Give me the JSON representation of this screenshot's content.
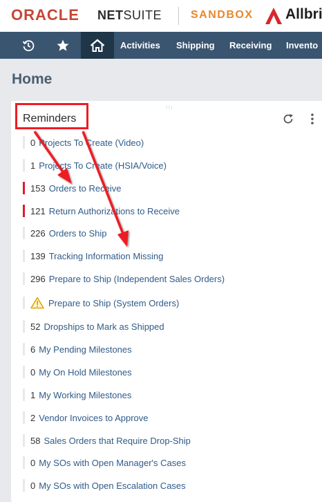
{
  "header": {
    "brand_oracle": "ORACLE",
    "brand_netsuite_bold": "NET",
    "brand_netsuite_rest": "SUITE",
    "environment": "SANDBOX",
    "company": "Allbri"
  },
  "nav": {
    "icons": [
      "recent-records-icon",
      "favorites-star-icon",
      "home-icon"
    ],
    "items": [
      "Activities",
      "Shipping",
      "Receiving",
      "Invento"
    ]
  },
  "page": {
    "title": "Home"
  },
  "portlet": {
    "title": "Reminders",
    "reminders": [
      {
        "count": "0",
        "label": "Projects To Create (Video)",
        "alert": false
      },
      {
        "count": "1",
        "label": "Projects To Create (HSIA/Voice)",
        "alert": false
      },
      {
        "count": "153",
        "label": "Orders to Receive",
        "alert": true
      },
      {
        "count": "121",
        "label": "Return Authorizations to Receive",
        "alert": true
      },
      {
        "count": "226",
        "label": "Orders to Ship",
        "alert": false
      },
      {
        "count": "139",
        "label": "Tracking Information Missing",
        "alert": false
      },
      {
        "count": "296",
        "label": "Prepare to Ship (Independent Sales Orders)",
        "alert": false
      },
      {
        "count": "",
        "label": "Prepare to Ship (System Orders)",
        "alert": false,
        "warning": true
      },
      {
        "count": "52",
        "label": "Dropships to Mark as Shipped",
        "alert": false
      },
      {
        "count": "6",
        "label": "My Pending Milestones",
        "alert": false
      },
      {
        "count": "0",
        "label": "My On Hold Milestones",
        "alert": false
      },
      {
        "count": "1",
        "label": "My Working Milestones",
        "alert": false
      },
      {
        "count": "2",
        "label": "Vendor Invoices to Approve",
        "alert": false
      },
      {
        "count": "58",
        "label": "Sales Orders that Require Drop-Ship",
        "alert": false
      },
      {
        "count": "0",
        "label": "My SOs with Open Manager's Cases",
        "alert": false
      },
      {
        "count": "0",
        "label": "My SOs with Open Escalation Cases",
        "alert": false
      }
    ]
  },
  "colors": {
    "oracle_red": "#c74634",
    "sandbox_orange": "#e8882b",
    "nav_bg": "#3a5570",
    "link": "#2f5b88",
    "annotation_red": "#ee1b24"
  }
}
